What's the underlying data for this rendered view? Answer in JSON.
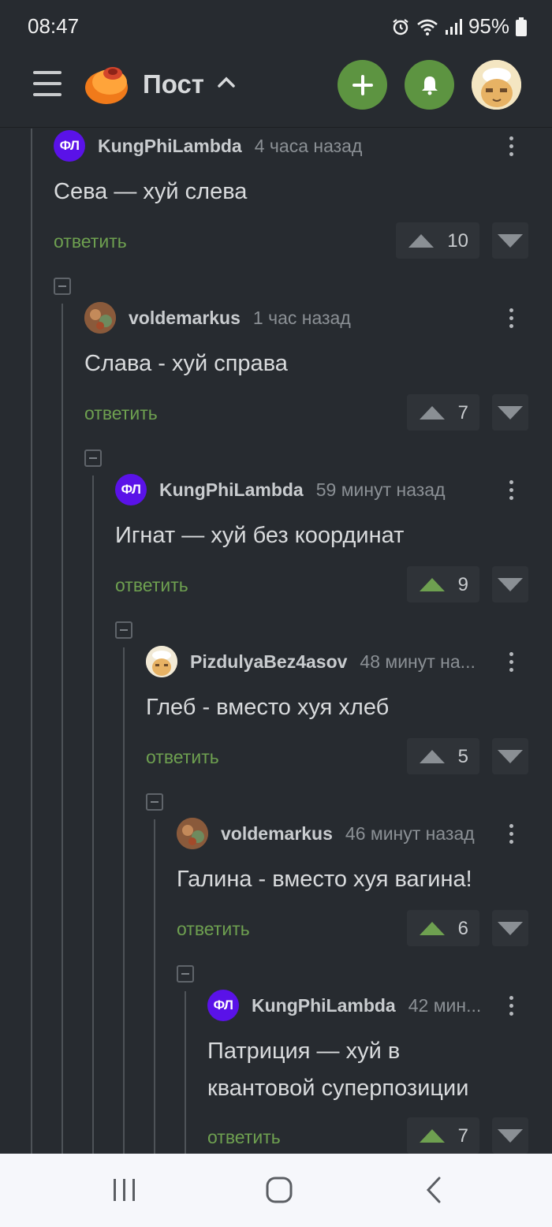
{
  "status_bar": {
    "time": "08:47",
    "battery": "95%"
  },
  "header": {
    "title": "Пост",
    "icons": [
      "menu-icon",
      "pikabu-logo",
      "chevron-up-icon",
      "plus-icon",
      "bell-icon",
      "avatar"
    ]
  },
  "colors": {
    "background": "#272b30",
    "accent_green": "#5d9441",
    "reply_green": "#6ea050",
    "avatar_purple": "#5a12e8"
  },
  "comments": [
    {
      "author": "KungPhiLambda",
      "avatar": "ФЛ",
      "time": "4 часа назад",
      "text": "Сева — хуй слева",
      "reply": "ответить",
      "votes": "10",
      "upvoted": false
    },
    {
      "author": "voldemarkus",
      "avatar": "",
      "time": "1 час назад",
      "text": "Слава - хуй справа",
      "reply": "ответить",
      "votes": "7",
      "upvoted": false
    },
    {
      "author": "KungPhiLambda",
      "avatar": "ФЛ",
      "time": "59 минут назад",
      "text": "Игнат — хуй без координат",
      "reply": "ответить",
      "votes": "9",
      "upvoted": true
    },
    {
      "author": "PizdulyaBez4asov",
      "avatar": "",
      "time": "48 минут на...",
      "text": "Глеб - вместо хуя хлеб",
      "reply": "ответить",
      "votes": "5",
      "upvoted": false
    },
    {
      "author": "voldemarkus",
      "avatar": "",
      "time": "46 минут назад",
      "text": "Галина - вместо хуя вагина!",
      "reply": "ответить",
      "votes": "6",
      "upvoted": true
    },
    {
      "author": "KungPhiLambda",
      "avatar": "ФЛ",
      "time": "42 мин...",
      "text_line1": "Патриция — хуй в",
      "text_line2": "квантовой суперпозиции",
      "reply": "ответить",
      "votes": "7",
      "upvoted": true
    }
  ],
  "nav": {
    "icons": [
      "recent-apps-icon",
      "home-icon",
      "back-icon"
    ]
  }
}
